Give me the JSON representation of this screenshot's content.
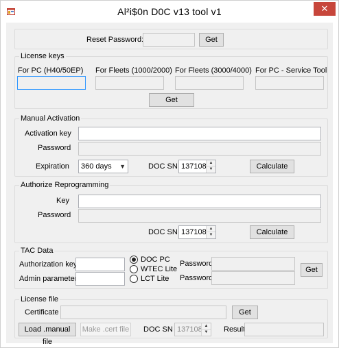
{
  "window": {
    "title": "Al²i$0n D0C v13 tool v1",
    "close_glyph": "✕"
  },
  "reset": {
    "label": "Reset Password:",
    "value": "",
    "get_label": "Get"
  },
  "license_keys": {
    "title": "License keys",
    "fields": [
      {
        "label": "For PC (H40/50EP)",
        "value": ""
      },
      {
        "label": "For Fleets (1000/2000)",
        "value": ""
      },
      {
        "label": "For Fleets (3000/4000)",
        "value": ""
      },
      {
        "label": "For PC - Service Tool",
        "value": ""
      }
    ],
    "get_label": "Get"
  },
  "manual_activation": {
    "title": "Manual Activation",
    "activation_key_label": "Activation key",
    "activation_key_value": "",
    "password_label": "Password",
    "password_value": "",
    "expiration_label": "Expiration",
    "expiration_value": "360 days",
    "doc_sn_label": "DOC SN",
    "doc_sn_value": "137108",
    "calculate_label": "Calculate"
  },
  "authorize_reprogramming": {
    "title": "Authorize Reprogramming",
    "key_label": "Key",
    "key_value": "",
    "password_label": "Password",
    "password_value": "",
    "doc_sn_label": "DOC SN",
    "doc_sn_value": "137108",
    "calculate_label": "Calculate"
  },
  "tac_data": {
    "title": "TAC Data",
    "auth_key_label": "Authorization key",
    "auth_key_value": "",
    "admin_params_label": "Admin parameters",
    "admin_params_value": "",
    "radios": [
      {
        "label": "DOC PC",
        "selected": true
      },
      {
        "label": "WTEC Lite",
        "selected": false
      },
      {
        "label": "LCT Lite",
        "selected": false
      }
    ],
    "password1_label": "Password",
    "password2_label": "Password",
    "get_label": "Get"
  },
  "license_file": {
    "title": "License file",
    "certificate_label": "Certificate",
    "certificate_value": "",
    "get_label": "Get",
    "load_label": "Load .manual file",
    "make_label": "Make .cert file",
    "doc_sn_label": "DOC SN",
    "doc_sn_value": "137108",
    "result_label": "Result",
    "result_value": ""
  },
  "colors": {
    "close_button": "#c7463b",
    "focus_border": "#3399ff",
    "client_bg": "#f0f0f0"
  }
}
